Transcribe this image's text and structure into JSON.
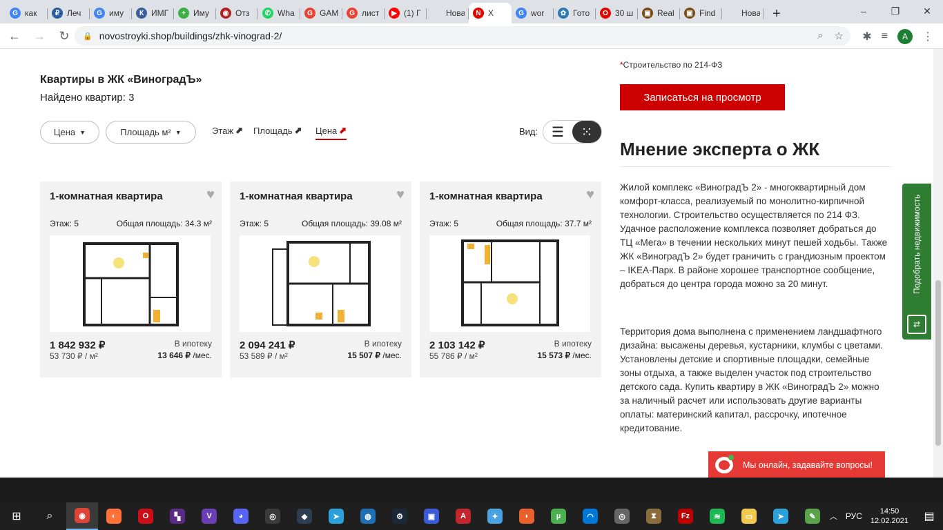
{
  "browser": {
    "tabs": [
      {
        "label": "как",
        "fav": "G",
        "color": "#4285f4"
      },
      {
        "label": "Леч",
        "fav": "₽",
        "color": "#2a5d9f"
      },
      {
        "label": "иму",
        "fav": "G",
        "color": "#4285f4"
      },
      {
        "label": "ИМГ",
        "fav": "К",
        "color": "#3d5f99"
      },
      {
        "label": "Иму",
        "fav": "+",
        "color": "#3cb043"
      },
      {
        "label": "Отз",
        "fav": "◉",
        "color": "#b22222"
      },
      {
        "label": "Wha",
        "fav": "✆",
        "color": "#25d366"
      },
      {
        "label": "GAM",
        "fav": "G",
        "color": "#ea4335"
      },
      {
        "label": "лист",
        "fav": "G",
        "color": "#ea4335"
      },
      {
        "label": "(1) Г",
        "fav": "▶",
        "color": "#ff0000"
      },
      {
        "label": "Новая в",
        "fav": "",
        "color": "#dee1e6"
      },
      {
        "label": "Х",
        "fav": "N",
        "color": "#e10600",
        "active": true
      },
      {
        "label": "wor",
        "fav": "G",
        "color": "#4285f4"
      },
      {
        "label": "Гото",
        "fav": "✿",
        "color": "#2b7bb9"
      },
      {
        "label": "30 ш",
        "fav": "O",
        "color": "#e10600"
      },
      {
        "label": "Real",
        "fav": "▣",
        "color": "#7a4a12"
      },
      {
        "label": "Find",
        "fav": "▣",
        "color": "#7a4a12"
      },
      {
        "label": "Новая в",
        "fav": "",
        "color": "#dee1e6"
      }
    ],
    "new_tab": "+",
    "url": "novostroyki.shop/buildings/zhk-vinograd-2/",
    "profile_initial": "A"
  },
  "listing": {
    "title": "Квартиры в ЖК «ВиноградЪ»",
    "found": "Найдено квартир: 3",
    "filter_price": "Цена",
    "filter_area": "Площадь м²",
    "sort_floor": "Этаж",
    "sort_area": "Площадь",
    "sort_price": "Цена",
    "view_label": "Вид:",
    "cards": [
      {
        "title": "1-комнатная квартира",
        "floor": "Этаж: 5",
        "area": "Общая площадь: 34.3 м²",
        "price": "1 842 932 ₽",
        "price_per_m2": "53 730 ₽ / м²",
        "mortgage_label": "В ипотеку",
        "monthly": "13 646 ₽",
        "monthly_suffix": "/мес."
      },
      {
        "title": "1-комнатная квартира",
        "floor": "Этаж: 5",
        "area": "Общая площадь: 39.08 м²",
        "price": "2 094 241 ₽",
        "price_per_m2": "53 589 ₽ / м²",
        "mortgage_label": "В ипотеку",
        "monthly": "15 507 ₽",
        "monthly_suffix": "/мес."
      },
      {
        "title": "1-комнатная квартира",
        "floor": "Этаж: 5",
        "area": "Общая площадь: 37.7 м²",
        "price": "2 103 142 ₽",
        "price_per_m2": "55 786 ₽ / м²",
        "mortgage_label": "В ипотеку",
        "monthly": "15 573 ₽",
        "monthly_suffix": "/мес."
      }
    ]
  },
  "sidebar": {
    "law_note": "Строительство по 214-ФЗ",
    "signup_button": "Записаться на просмотр",
    "expert_heading": "Мнение эксперта о ЖК",
    "expert_p1": "Жилой комплекс «ВиноградЪ 2» - многоквартирный дом комфорт-класса, реализуемый по монолитно-кирпичной технологии. Строительство осуществляется по 214 ФЗ. Удачное расположение комплекса позволяет добраться до ТЦ «Мега» в течении нескольких минут пешей ходьбы. Также ЖК «ВиноградЪ 2» будет граничить с грандиозным проектом – IKEA-Парк. В районе хорошее транспортное сообщение, добраться до центра города можно за 20 минут.",
    "expert_p2": "Территория дома выполнена с применением ландшафтного дизайна: высажены деревья, кустарники, клумбы с цветами. Установлены детские и спортивные площадки, семейные зоны отдыха, а также выделен участок под строительство детского сада. Купить квартиру в ЖК «ВиноградЪ 2» можно за наличный расчет или использовать другие варианты оплаты: материнский капитал, рассрочку, ипотечное кредитование.",
    "side_tab": "Подобрать недвижимость",
    "chat": "Мы онлайн, задавайте вопросы!"
  },
  "colors": {
    "accent": "#cc0000",
    "side_tab": "#2e7d32",
    "chat": "#e53935"
  },
  "taskbar": {
    "apps": [
      {
        "name": "chrome",
        "color": "#db4437",
        "glyph": "◉",
        "active": true
      },
      {
        "name": "firefox",
        "color": "#ff7139",
        "glyph": "◐"
      },
      {
        "name": "opera",
        "color": "#cc0f16",
        "glyph": "O"
      },
      {
        "name": "purple-app",
        "color": "#5b2a86",
        "glyph": "▚"
      },
      {
        "name": "vs-app",
        "color": "#6a3fb5",
        "glyph": "V"
      },
      {
        "name": "discord",
        "color": "#5865f2",
        "glyph": "◕"
      },
      {
        "name": "grammarly",
        "color": "#3a3a3a",
        "glyph": "◎"
      },
      {
        "name": "cube-app",
        "color": "#2d3e50",
        "glyph": "◆"
      },
      {
        "name": "telegram",
        "color": "#2aa1da",
        "glyph": "➤"
      },
      {
        "name": "globe-app",
        "color": "#1f6fb5",
        "glyph": "◍"
      },
      {
        "name": "steam",
        "color": "#1b2838",
        "glyph": "⚙"
      },
      {
        "name": "shield-app",
        "color": "#3b5bdb",
        "glyph": "▣"
      },
      {
        "name": "autocad",
        "color": "#c4262e",
        "glyph": "A"
      },
      {
        "name": "tools-app",
        "color": "#4aa3df",
        "glyph": "✦"
      },
      {
        "name": "blade-app",
        "color": "#e8612c",
        "glyph": "◗"
      },
      {
        "name": "utorrent",
        "color": "#4caf50",
        "glyph": "µ"
      },
      {
        "name": "edge",
        "color": "#0078d7",
        "glyph": "◠"
      },
      {
        "name": "disc-app",
        "color": "#666666",
        "glyph": "◎"
      },
      {
        "name": "hourglass-app",
        "color": "#8a6d3b",
        "glyph": "⧗"
      },
      {
        "name": "filezilla",
        "color": "#bf0000",
        "glyph": "Fz"
      },
      {
        "name": "spotify",
        "color": "#1db954",
        "glyph": "≋"
      },
      {
        "name": "explorer",
        "color": "#f2c94c",
        "glyph": "▭"
      },
      {
        "name": "telegram-2",
        "color": "#2aa1da",
        "glyph": "➤"
      },
      {
        "name": "notes-app",
        "color": "#5aa34a",
        "glyph": "✎"
      }
    ],
    "lang": "РУС",
    "time": "14:50",
    "date": "12.02.2021"
  }
}
